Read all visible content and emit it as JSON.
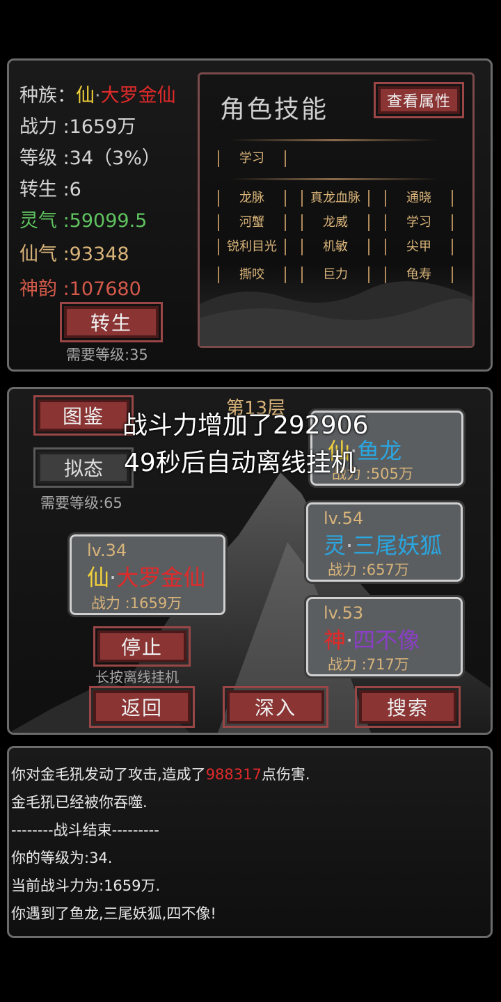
{
  "profile": {
    "race_label": "种族：",
    "race_prefix": "仙",
    "race_dot": "·",
    "race_name": "大罗金仙",
    "power": "战力 :1659万",
    "level": "等级 :34（3%）",
    "rebirth": "转生 :6",
    "lingqi": "灵气 :59099.5",
    "xianqi": "仙气 :93348",
    "shenyun": "神韵 :107680",
    "rebirth_button": "转生",
    "rebirth_req": "需要等级:35"
  },
  "skills": {
    "title": "角色技能",
    "view_attr_button": "查看属性",
    "learn": "学习",
    "list": [
      "龙脉",
      "真龙血脉",
      "通晓",
      "河蟹",
      "龙威",
      "学习",
      "锐利目光",
      "机敏",
      "尖甲",
      "撕咬",
      "巨力",
      "龟寿"
    ]
  },
  "battle": {
    "floor": "第13层",
    "codex_button": "图鉴",
    "mimic_button": "拟态",
    "mimic_req": "需要等级:65",
    "overlay_line1": "战斗力增加了292906",
    "overlay_line2": "49秒后自动离线挂机",
    "player": {
      "lv": "lv.34",
      "prefix": "仙",
      "dot": "·",
      "name": "大罗金仙",
      "power": "战力 :1659万"
    },
    "enemies": [
      {
        "lv": "",
        "prefix": "仙",
        "dot": "·",
        "name": "鱼龙",
        "power": "战力 :505万"
      },
      {
        "lv": "lv.54",
        "prefix": "灵",
        "dot": "·",
        "name": "三尾妖狐",
        "power": "战力 :657万"
      },
      {
        "lv": "lv.53",
        "prefix": "神",
        "dot": "·",
        "name": "四不像",
        "power": "战力 :717万"
      }
    ],
    "stop_button": "停止",
    "stop_hint": "长按离线挂机",
    "back_button": "返回",
    "deep_button": "深入",
    "search_button": "搜索"
  },
  "log": {
    "line1_a": "你对金毛犼发动了攻击,造成了",
    "line1_num": "988317",
    "line1_b": "点伤害.",
    "line2": "金毛犼已经被你吞噬.",
    "line3": "--------战斗结束---------",
    "line4": "你的等级为:34.",
    "line5": "当前战斗力为:1659万.",
    "line6": "你遇到了鱼龙,三尾妖狐,四不像!"
  },
  "colors": {
    "xian": "#f2d13a",
    "red_name": "#e02a2a",
    "ling": "#2aa6e0",
    "shen": "#e02a2a",
    "purple": "#8a3fc4",
    "lingqi": "#5fc35f",
    "xianqi": "#d9b47a",
    "shenyun": "#d45a4a",
    "damage": "#e02a2a"
  }
}
